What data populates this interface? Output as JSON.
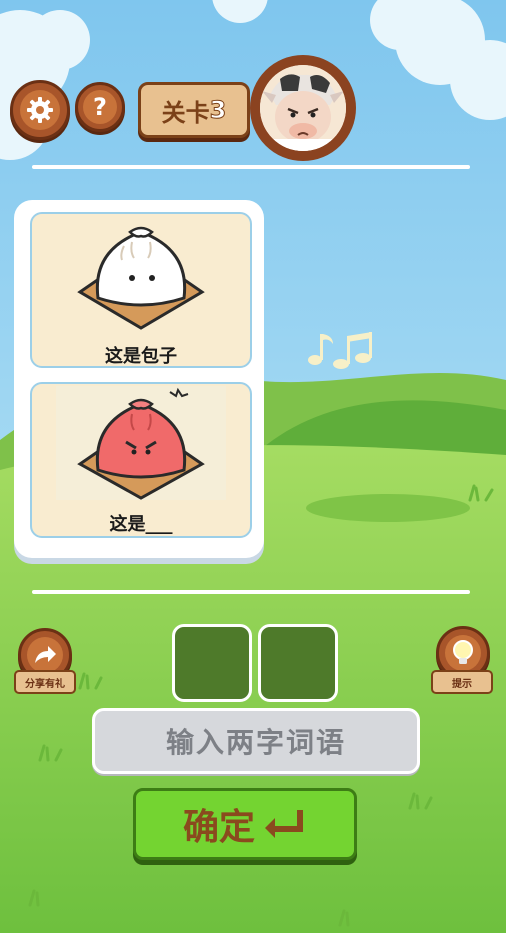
{
  "header": {
    "level_label": "关卡",
    "level_number": "3"
  },
  "puzzle": {
    "panel1_caption": "这是包子",
    "panel2_caption": "这是___"
  },
  "actions": {
    "share_label": "分享有礼",
    "hint_label": "提示",
    "answer_slots": [
      "",
      ""
    ],
    "input_placeholder": "输入两字词语",
    "confirm_label": "确定"
  },
  "colors": {
    "sky": "#a9dcf5",
    "grass": "#8fd153",
    "accent_green": "#74d431",
    "wood": "#a8552a"
  },
  "icons": [
    "gear-icon",
    "question-icon",
    "share-arrow-icon",
    "lightbulb-icon",
    "enter-icon",
    "music-notes-icon"
  ]
}
